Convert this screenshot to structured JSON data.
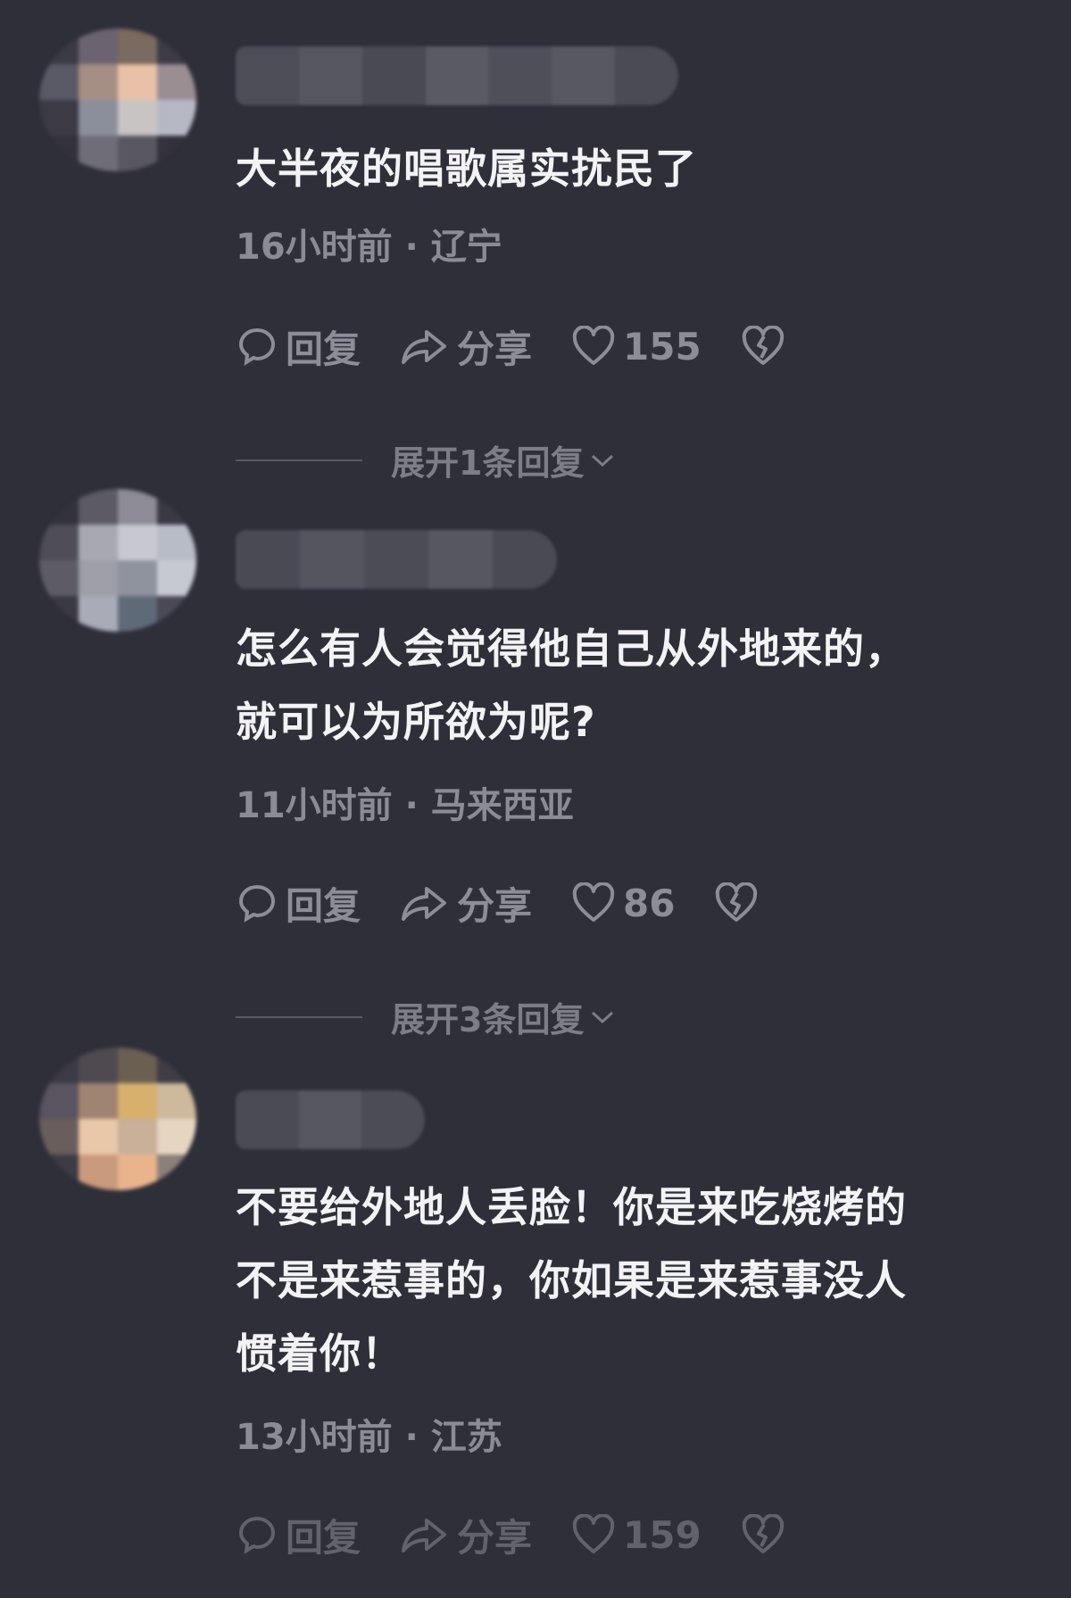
{
  "comments": [
    {
      "text": "大半夜的唱歌属实扰民了",
      "meta": "16小时前 · 辽宁",
      "reply_label": "回复",
      "share_label": "分享",
      "likes": "155",
      "expand_label": "展开1条回复"
    },
    {
      "text": "怎么有人会觉得他自己从外地来的，\n就可以为所欲为呢?",
      "meta": "11小时前 · 马来西亚",
      "reply_label": "回复",
      "share_label": "分享",
      "likes": "86",
      "expand_label": "展开3条回复"
    },
    {
      "text": "不要给外地人丢脸！你是来吃烧烤的\n不是来惹事的，你如果是来惹事没人\n惯着你！",
      "meta": "13小时前 · 江苏",
      "reply_label": "回复",
      "share_label": "分享",
      "likes": "159"
    }
  ],
  "colors": {
    "background": "#2f2f3a",
    "text": "#f3f3f6",
    "muted": "#8b8b96"
  },
  "icons": [
    "comment-bubble-icon",
    "share-arrow-icon",
    "heart-icon",
    "broken-heart-icon",
    "chevron-down-icon"
  ]
}
